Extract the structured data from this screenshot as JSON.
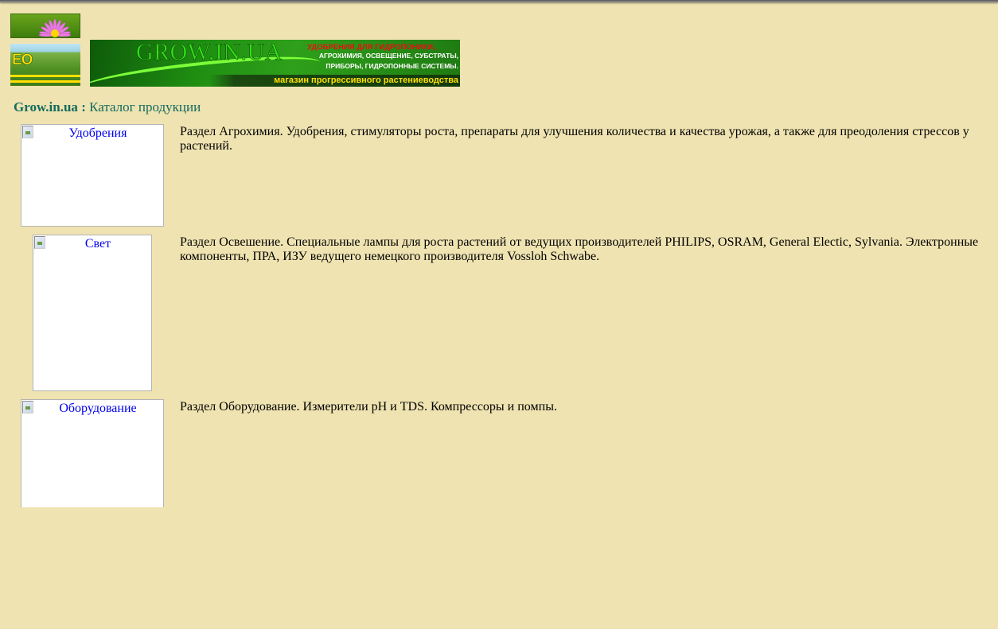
{
  "header": {
    "banner": {
      "title": "GROW.IN.UA",
      "tagline_red": "УДОБРЕНИЯ ДЛЯ ГИДРОПОНИКИ,",
      "tagline_line1": "АГРОХИМИЯ, ОСВЕЩЕНИЕ, СУБСТРАТЫ,",
      "tagline_line2": "ПРИБОРЫ, ГИДРОПОННЫЕ СИСТЕМЫ.",
      "slogan": "магазин прогрессивного растениеводства"
    },
    "logo_eo_text": "EO",
    "colors": {
      "page_background": "#efe3b1",
      "breadcrumb_text": "#136b5e",
      "link_text": "#0000ee",
      "banner_green": "#2ea01a",
      "banner_red": "#e81010",
      "banner_yellow": "#ffe000"
    }
  },
  "breadcrumb": {
    "site": "Grow.in.ua",
    "separator": " : ",
    "current": "Каталог продукции"
  },
  "catalog": {
    "items": [
      {
        "image_alt": "Удобрения",
        "description": "Раздел Агрохимия. Удобрения, стимуляторы роста, препараты для улучшения количества и качества урожая, а также для преодоления стрессов у растений."
      },
      {
        "image_alt": "Свет",
        "description": "Раздел Освешение. Специальные лампы для роста растений от ведущих производителей PHILIPS, OSRAM, General Electic, Sylvania. Электронные компоненты, ПРА, ИЗУ ведущего немецкого производителя Vossloh Schwabe."
      },
      {
        "image_alt": "Оборудование",
        "description": "Раздел Оборудование. Измерители pH и TDS. Компрессоры и помпы."
      }
    ]
  }
}
